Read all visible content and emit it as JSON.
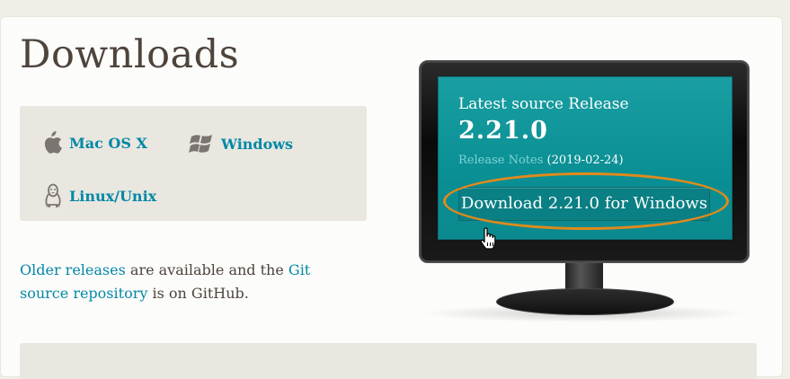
{
  "page": {
    "title": "Downloads"
  },
  "os_links": [
    {
      "label": "Mac OS X",
      "icon": "apple-icon"
    },
    {
      "label": "Windows",
      "icon": "windows-icon"
    },
    {
      "label": "Linux/Unix",
      "icon": "linux-penguin-icon"
    }
  ],
  "older": {
    "link1": "Older releases",
    "text1": " are available and the ",
    "link2": "Git source repository",
    "text2": " is on GitHub."
  },
  "release": {
    "label": "Latest source Release",
    "version": "2.21.0",
    "notes_link": "Release Notes",
    "date": "(2019-02-24)",
    "download_button": "Download 2.21.0 for Windows"
  },
  "colors": {
    "link": "#0388a6",
    "screen": "#0a8f94",
    "highlight": "#e08a1c",
    "text": "#4e443c"
  }
}
